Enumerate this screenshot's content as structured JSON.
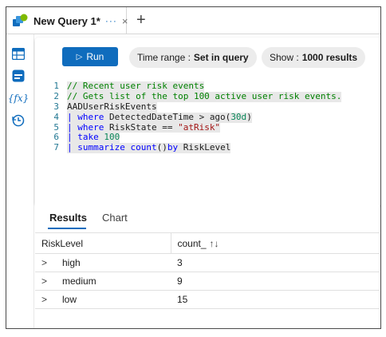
{
  "tab": {
    "title": "New Query 1*",
    "more": "···",
    "close": "×",
    "add": "+"
  },
  "toolbar": {
    "run_label": "Run",
    "time_range_label": "Time range :",
    "time_range_value": "Set in query",
    "show_label": "Show :",
    "show_value": "1000 results"
  },
  "code": {
    "lines": [
      {
        "n": "1",
        "text": "// Recent user risk events"
      },
      {
        "n": "2",
        "text": "// Gets list of the top 100 active user risk events."
      },
      {
        "n": "3",
        "text": "AADUserRiskEvents"
      },
      {
        "n": "4",
        "text": "| where DetectedDateTime > ago(30d)"
      },
      {
        "n": "5",
        "text": "| where RiskState == \"atRisk\""
      },
      {
        "n": "6",
        "text": "| take 100"
      },
      {
        "n": "7",
        "text": "| summarize count()by RiskLevel"
      }
    ]
  },
  "results": {
    "tabs": [
      "Results",
      "Chart"
    ],
    "columns": [
      "RiskLevel",
      "count_"
    ],
    "rows": [
      {
        "risk": "high",
        "count": "3"
      },
      {
        "risk": "medium",
        "count": "9"
      },
      {
        "risk": "low",
        "count": "15"
      }
    ]
  },
  "colors": {
    "accent": "#0f6cbd",
    "comment": "#008000",
    "keyword": "#0000ff",
    "string": "#a31515"
  }
}
